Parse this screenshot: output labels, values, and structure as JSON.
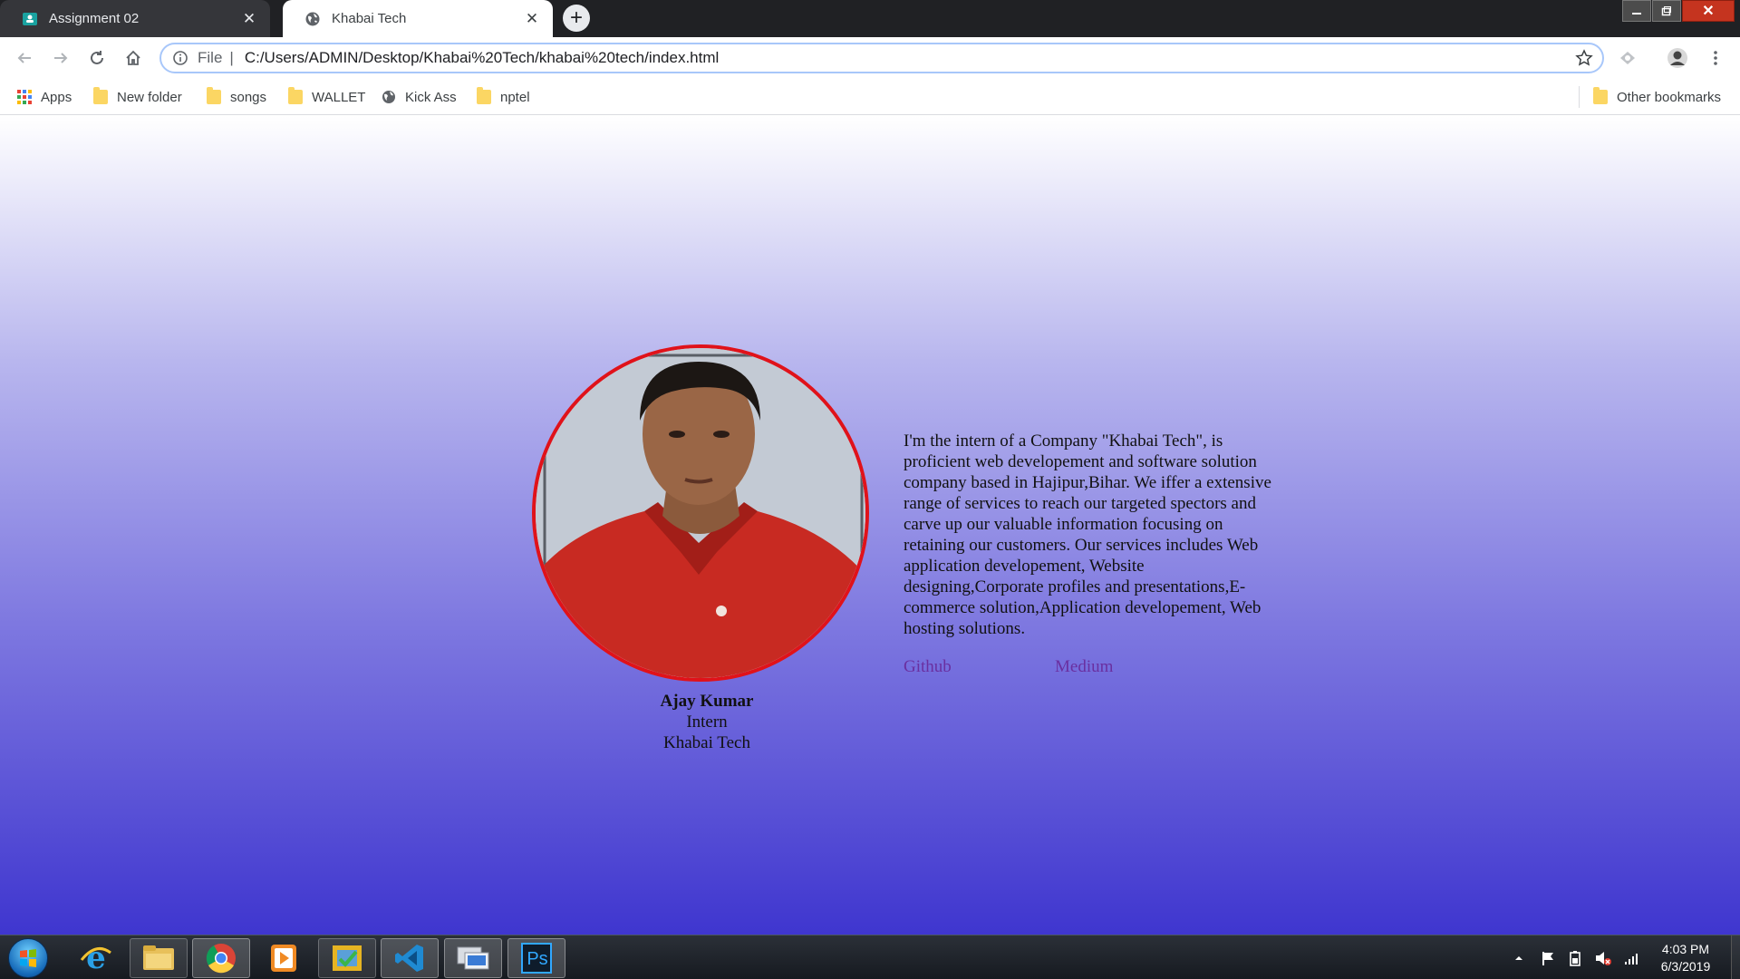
{
  "browser": {
    "tabs": [
      {
        "title": "Assignment 02",
        "icon": "classroom-icon",
        "active": false
      },
      {
        "title": "Khabai Tech",
        "icon": "globe-icon",
        "active": true
      }
    ],
    "window_controls": [
      "minimize",
      "maximize",
      "close"
    ],
    "address": {
      "scheme_label": "File",
      "url": "C:/Users/ADMIN/Desktop/Khabai%20Tech/khabai%20tech/index.html"
    },
    "bookmarks": [
      {
        "label": "Apps",
        "icon": "apps-grid-icon"
      },
      {
        "label": "New folder",
        "icon": "folder-icon"
      },
      {
        "label": "songs",
        "icon": "folder-icon"
      },
      {
        "label": "WALLET",
        "icon": "folder-icon"
      },
      {
        "label": "Kick Ass",
        "icon": "globe-icon"
      },
      {
        "label": "nptel",
        "icon": "folder-icon"
      }
    ],
    "other_bookmarks": "Other bookmarks"
  },
  "profile": {
    "name": "Ajay Kumar",
    "role": "Intern",
    "company": "Khabai Tech",
    "bio": "I'm the intern of a Company \"Khabai Tech\", is proficient web developement and software solution company based in Hajipur,Bihar. We iffer a extensive range of services to reach our targeted spectors and carve up our valuable information focusing on retaining our customers. Our services includes Web application developement, Website designing,Corporate profiles and presentations,E-commerce solution,Application developement, Web hosting solutions.",
    "links": [
      {
        "label": "Github"
      },
      {
        "label": "Medium"
      }
    ]
  },
  "colors": {
    "photo_border": "#e0121a",
    "link": "#6a2fa0",
    "gradient_top": "#ffffff",
    "gradient_bottom": "#3f36cf"
  },
  "taskbar": {
    "apps": [
      "start-orb",
      "internet-explorer",
      "file-explorer",
      "chrome",
      "media-player",
      "windows-tool",
      "vscode",
      "remote-desktop",
      "photoshop"
    ],
    "photoshop_label": "Ps",
    "clock": {
      "time": "4:03 PM",
      "date": "6/3/2019"
    }
  }
}
